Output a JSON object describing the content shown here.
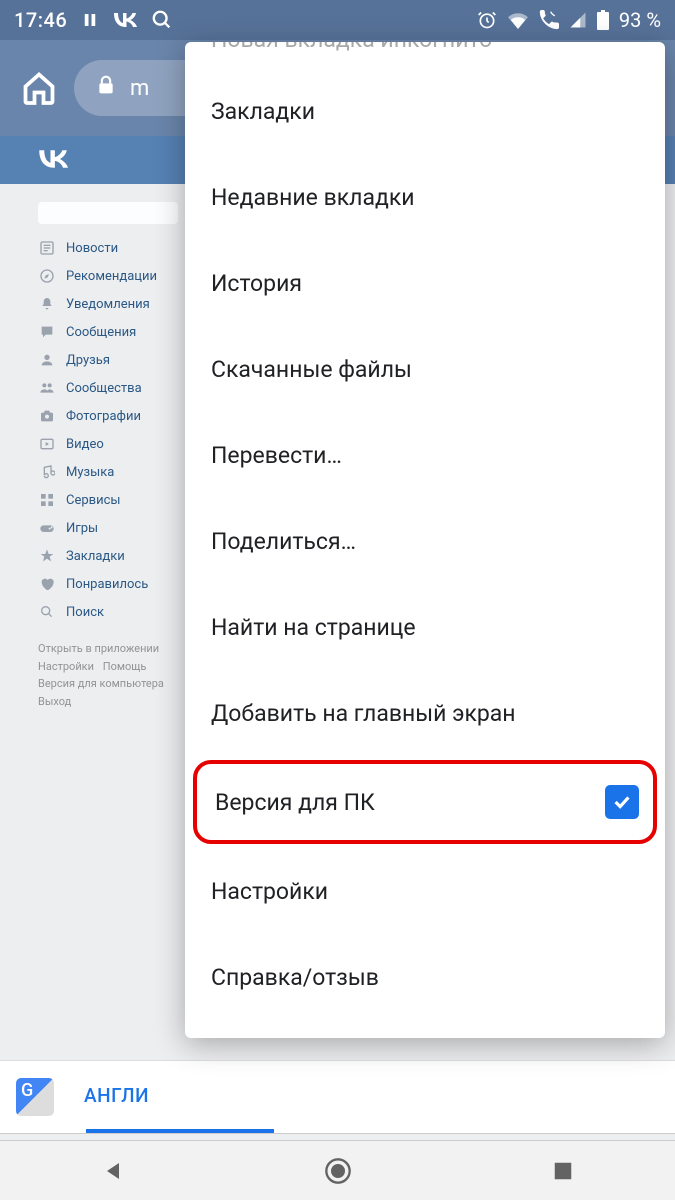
{
  "statusbar": {
    "time": "17:46",
    "battery": "93 %"
  },
  "browser": {
    "url_visible": "m"
  },
  "vk_sidebar": {
    "items": [
      {
        "label": "Новости",
        "icon": "news"
      },
      {
        "label": "Рекомендации",
        "icon": "compass"
      },
      {
        "label": "Уведомления",
        "icon": "bell"
      },
      {
        "label": "Сообщения",
        "icon": "chat"
      },
      {
        "label": "Друзья",
        "icon": "user"
      },
      {
        "label": "Сообщества",
        "icon": "users"
      },
      {
        "label": "Фотографии",
        "icon": "camera"
      },
      {
        "label": "Видео",
        "icon": "video"
      },
      {
        "label": "Музыка",
        "icon": "music"
      },
      {
        "label": "Сервисы",
        "icon": "services"
      },
      {
        "label": "Игры",
        "icon": "game"
      },
      {
        "label": "Закладки",
        "icon": "star"
      },
      {
        "label": "Понравилось",
        "icon": "heart"
      },
      {
        "label": "Поиск",
        "icon": "search"
      }
    ],
    "footer": {
      "open_app": "Открыть в приложении",
      "settings": "Настройки",
      "help": "Помощь",
      "desktop": "Версия для компьютера",
      "logout": "Выход"
    }
  },
  "chrome_menu": {
    "partial_top": "Новая вкладка инкогнито",
    "items": [
      "Закладки",
      "Недавние вкладки",
      "История",
      "Скачанные файлы",
      "Перевести…",
      "Поделиться…",
      "Найти на странице",
      "Добавить на главный экран",
      "Версия для ПК",
      "Настройки",
      "Справка/отзыв"
    ],
    "highlighted_index": 8,
    "checked_index": 8
  },
  "translate_bar": {
    "tab": "АНГЛИ"
  }
}
